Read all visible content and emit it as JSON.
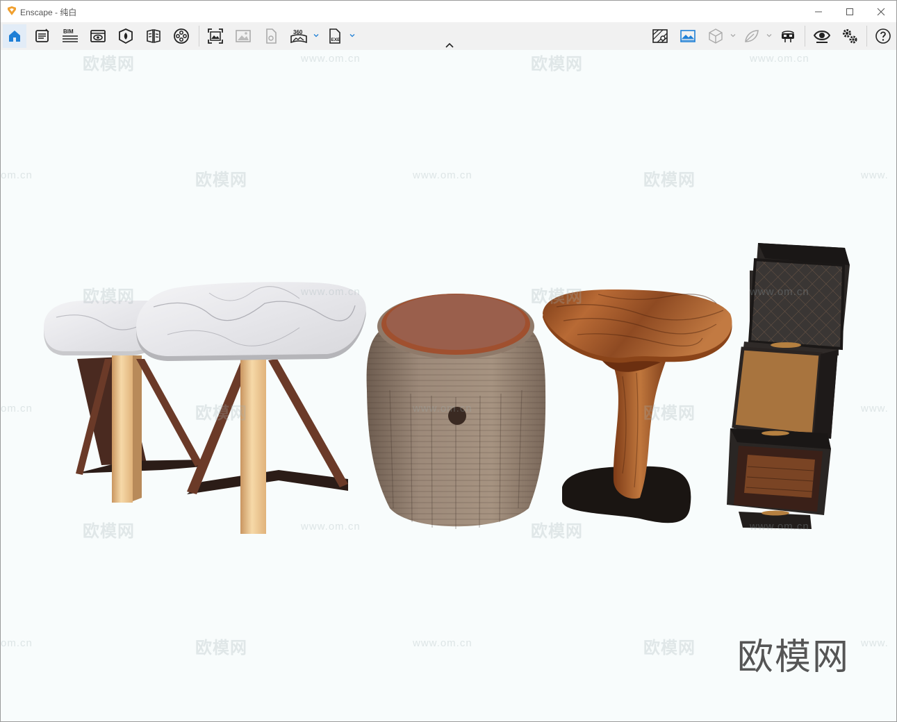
{
  "window": {
    "app_name": "Enscape",
    "separator": " - ",
    "doc_name": "纯白"
  },
  "toolbar": {
    "left_buttons": [
      {
        "name": "home-icon",
        "active": true
      },
      {
        "name": "feedback-icon"
      },
      {
        "name": "bim-icon",
        "label": "BIM"
      },
      {
        "name": "views-eye-icon"
      },
      {
        "name": "asset-library-icon"
      },
      {
        "name": "material-editor-icon"
      },
      {
        "name": "video-editor-icon"
      },
      {
        "name": "screenshot-icon"
      },
      {
        "name": "batch-render-icon"
      },
      {
        "name": "upload-icon"
      },
      {
        "name": "panorama-360-icon",
        "label": "360"
      },
      {
        "name": "export-exe-icon",
        "label": "EXE"
      }
    ],
    "right_buttons": [
      {
        "name": "map-icon"
      },
      {
        "name": "atmosphere-icon"
      },
      {
        "name": "cube-icon"
      },
      {
        "name": "leaf-icon"
      },
      {
        "name": "vr-headset-icon"
      },
      {
        "name": "visual-settings-eye-icon"
      },
      {
        "name": "settings-gears-icon"
      },
      {
        "name": "help-icon"
      }
    ]
  },
  "viewport": {
    "watermark_cn": "欧模网",
    "watermark_url": "www.om.cn",
    "watermark_url_partial_left": "om.cn",
    "watermark_url_partial_right": "www.",
    "corner_logo": "欧模网"
  },
  "colors": {
    "accent": "#1e7fd6",
    "logo_orange": "#f0a030",
    "viewport_bg": "#f8fcfc"
  }
}
